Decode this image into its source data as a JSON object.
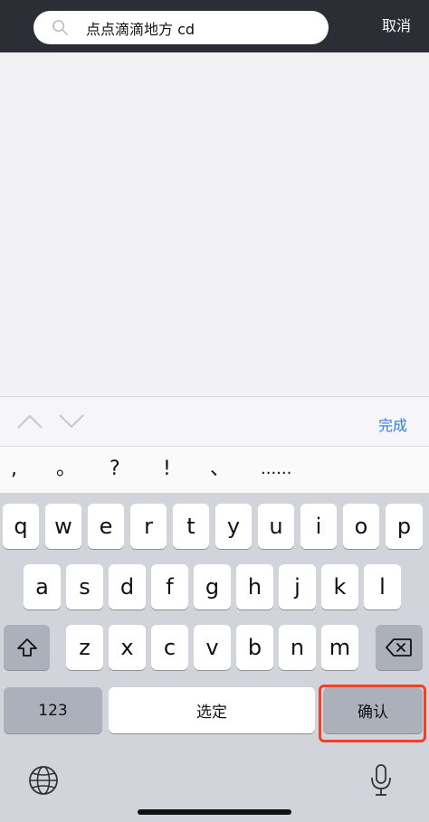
{
  "search": {
    "value": "点点滴滴地方 cd",
    "cancel_label": "取消"
  },
  "accessory": {
    "done_label": "完成"
  },
  "punctuation": [
    ",",
    "。",
    "?",
    "!",
    "、",
    "......"
  ],
  "keyboard": {
    "row1": [
      "q",
      "w",
      "e",
      "r",
      "t",
      "y",
      "u",
      "i",
      "o",
      "p"
    ],
    "row2": [
      "a",
      "s",
      "d",
      "f",
      "g",
      "h",
      "j",
      "k",
      "l"
    ],
    "row3": [
      "z",
      "x",
      "c",
      "v",
      "b",
      "n",
      "m"
    ],
    "numbers_label": "123",
    "select_label": "选定",
    "confirm_label": "确认"
  },
  "colors": {
    "topbar": "#2b2e35",
    "accent": "#2f7de1",
    "highlight": "#ee4127",
    "keyboard_bg": "#d1d4db"
  }
}
